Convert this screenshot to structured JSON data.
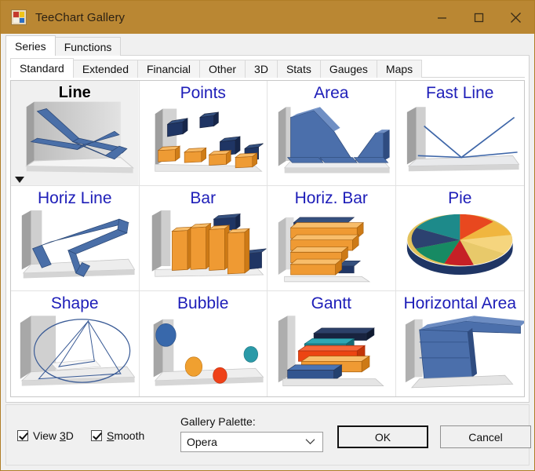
{
  "window": {
    "title": "TeeChart Gallery",
    "icon": "teechart-app-icon",
    "controls": {
      "minimize": "minimize-icon",
      "maximize": "maximize-icon",
      "close": "close-icon"
    },
    "titlebar_color": "#ba8733"
  },
  "outer_tabs": [
    {
      "label": "Series",
      "active": true
    },
    {
      "label": "Functions",
      "active": false
    }
  ],
  "inner_tabs": [
    {
      "label": "Standard",
      "active": true
    },
    {
      "label": "Extended",
      "active": false
    },
    {
      "label": "Financial",
      "active": false
    },
    {
      "label": "Other",
      "active": false
    },
    {
      "label": "3D",
      "active": false
    },
    {
      "label": "Stats",
      "active": false
    },
    {
      "label": "Gauges",
      "active": false
    },
    {
      "label": "Maps",
      "active": false
    }
  ],
  "gallery": {
    "selected_index": 0,
    "items": [
      {
        "label": "Line",
        "type": "line",
        "selected": true
      },
      {
        "label": "Points",
        "type": "points",
        "selected": false
      },
      {
        "label": "Area",
        "type": "area",
        "selected": false
      },
      {
        "label": "Fast Line",
        "type": "fastline",
        "selected": false
      },
      {
        "label": "Horiz Line",
        "type": "horizline",
        "selected": false
      },
      {
        "label": "Bar",
        "type": "bar",
        "selected": false
      },
      {
        "label": "Horiz. Bar",
        "type": "horizbar",
        "selected": false
      },
      {
        "label": "Pie",
        "type": "pie",
        "selected": false
      },
      {
        "label": "Shape",
        "type": "shape",
        "selected": false
      },
      {
        "label": "Bubble",
        "type": "bubble",
        "selected": false
      },
      {
        "label": "Gantt",
        "type": "gantt",
        "selected": false
      },
      {
        "label": "Horizontal Area",
        "type": "horizarea",
        "selected": false
      }
    ]
  },
  "bottom": {
    "view3d": {
      "label_pre": "View ",
      "accel": "3",
      "label_post": "D",
      "checked": true
    },
    "smooth": {
      "accel": "S",
      "label_post": "mooth",
      "checked": true
    },
    "palette": {
      "label": "Gallery Palette:",
      "value": "Opera",
      "options": [
        "Opera"
      ]
    },
    "ok_label": "OK",
    "cancel_label": "Cancel"
  },
  "colors": {
    "accent_title": "#1d1db8",
    "titlebar": "#ba8733",
    "chart_blue": "#3a5f9e",
    "chart_orange": "#ef9a33"
  }
}
